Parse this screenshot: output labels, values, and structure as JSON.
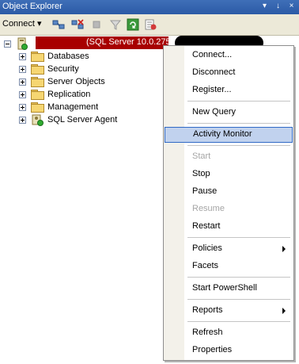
{
  "window": {
    "title": "Object Explorer",
    "pin_glyph": "↓",
    "close_glyph": "×",
    "dropdown_glyph": "▾"
  },
  "toolbar": {
    "connect_label": "Connect ▾"
  },
  "tree": {
    "server_label": "(SQL Server 10.0.2757",
    "items": [
      {
        "label": "Databases"
      },
      {
        "label": "Security"
      },
      {
        "label": "Server Objects"
      },
      {
        "label": "Replication"
      },
      {
        "label": "Management"
      },
      {
        "label": "SQL Server Agent"
      }
    ]
  },
  "context_menu": {
    "connect": "Connect...",
    "disconnect": "Disconnect",
    "register": "Register...",
    "new_query": "New Query",
    "activity_monitor": "Activity Monitor",
    "start": "Start",
    "stop": "Stop",
    "pause": "Pause",
    "resume": "Resume",
    "restart": "Restart",
    "policies": "Policies",
    "facets": "Facets",
    "start_powershell": "Start PowerShell",
    "reports": "Reports",
    "refresh": "Refresh",
    "properties": "Properties"
  },
  "colors": {
    "title_bar": "#2b5aa6",
    "toolbar": "#ece9d8",
    "selection": "#c1d2ee",
    "selection_border": "#316ac5",
    "redaction": "#a80000"
  }
}
